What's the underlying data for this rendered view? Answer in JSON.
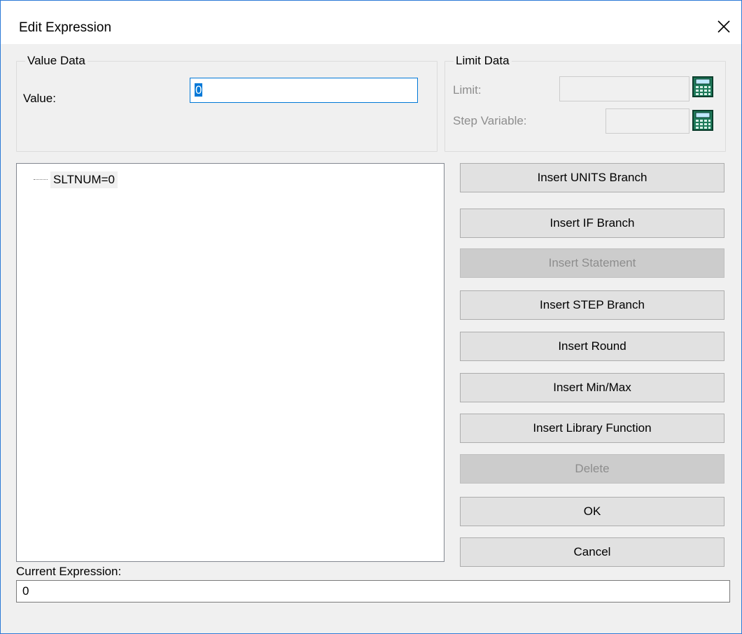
{
  "window": {
    "title": "Edit Expression",
    "close_icon": "close-icon"
  },
  "value_data": {
    "legend": "Value Data",
    "value_label": "Value:",
    "value": "0"
  },
  "limit_data": {
    "legend": "Limit Data",
    "limit_label": "Limit:",
    "limit_value": "",
    "step_label": "Step Variable:",
    "step_value": "",
    "calculator_icon": "calculator-icon"
  },
  "tree": {
    "items": [
      {
        "label": "SLTNUM=0"
      }
    ]
  },
  "buttons": {
    "insert_units": "Insert UNITS Branch",
    "insert_if": "Insert IF Branch",
    "insert_statement": "Insert Statement",
    "insert_step": "Insert STEP Branch",
    "insert_round": "Insert Round",
    "insert_minmax": "Insert Min/Max",
    "insert_library": "Insert Library Function",
    "delete": "Delete",
    "ok": "OK",
    "cancel": "Cancel"
  },
  "current_expression": {
    "label": "Current Expression:",
    "value": "0"
  },
  "colors": {
    "accent": "#0078d7",
    "window_border": "#2b79d6",
    "dialog_bg": "#f0f0f0",
    "calculator_body": "#1e7a5a"
  }
}
